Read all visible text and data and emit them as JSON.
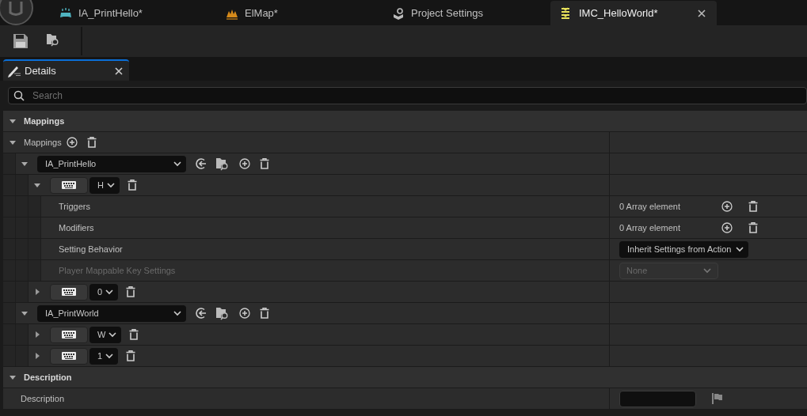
{
  "tabs": [
    {
      "label": "IA_PrintHello*",
      "selected": false
    },
    {
      "label": "ElMap*",
      "selected": false
    },
    {
      "label": "Project Settings",
      "selected": false
    },
    {
      "label": "IMC_HelloWorld*",
      "selected": true
    }
  ],
  "details": {
    "title": "Details",
    "search": {
      "placeholder": "Search"
    }
  },
  "sections": [
    {
      "title": "Mappings",
      "expanded": true,
      "items": [
        {
          "kind": "array",
          "label": "Mappings",
          "expanded": true,
          "children": [
            {
              "kind": "action",
              "value": "IA_PrintHello",
              "expanded": true,
              "children": [
                {
                  "kind": "key",
                  "key": "H",
                  "expanded": true,
                  "children": [
                    {
                      "kind": "array-prop",
                      "label": "Triggers",
                      "value": "0 Array element"
                    },
                    {
                      "kind": "array-prop",
                      "label": "Modifiers",
                      "value": "0 Array element"
                    },
                    {
                      "kind": "combo",
                      "label": "Setting Behavior",
                      "value": "Inherit Settings from Action",
                      "disabled": false
                    },
                    {
                      "kind": "combo",
                      "label": "Player Mappable Key Settings",
                      "value": "None",
                      "disabled": true
                    }
                  ]
                },
                {
                  "kind": "key",
                  "key": "0",
                  "expanded": false
                }
              ]
            },
            {
              "kind": "action",
              "value": "IA_PrintWorld",
              "expanded": true,
              "children": [
                {
                  "kind": "key",
                  "key": "W",
                  "expanded": false
                },
                {
                  "kind": "key",
                  "key": "1",
                  "expanded": false
                }
              ]
            }
          ]
        }
      ]
    },
    {
      "title": "Description",
      "expanded": true,
      "items": [
        {
          "kind": "text",
          "label": "Description"
        }
      ]
    }
  ]
}
